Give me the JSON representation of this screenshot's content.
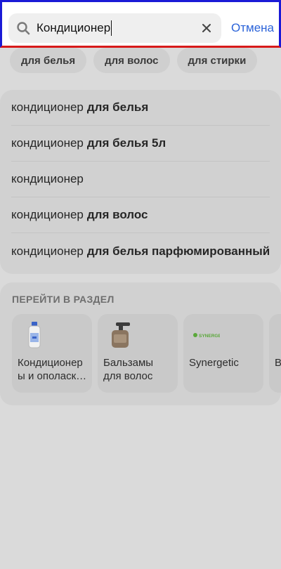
{
  "search": {
    "value": "Кондиционер",
    "cancel_label": "Отмена"
  },
  "chips": [
    {
      "label": "для белья"
    },
    {
      "label": "для волос"
    },
    {
      "label": "для стирки"
    }
  ],
  "suggestions": [
    {
      "prefix": "кондиционер",
      "bold": "для белья"
    },
    {
      "prefix": "кондиционер",
      "bold": "для белья 5л"
    },
    {
      "prefix": "кондиционер",
      "bold": ""
    },
    {
      "prefix": "кондиционер",
      "bold": "для волос"
    },
    {
      "prefix": "кондиционер",
      "bold": "для белья парфюмированный"
    }
  ],
  "sections": {
    "title": "ПЕРЕЙТИ В РАЗДЕЛ",
    "items": [
      {
        "label": "Кондиционер ы и ополаск…",
        "icon": "bottle-icon"
      },
      {
        "label": "Бальзамы для волос",
        "icon": "pump-bottle-icon"
      },
      {
        "label": "Synergetic",
        "icon": "synergetic-logo",
        "logo_text": "SYNERGETIC"
      },
      {
        "label": "В",
        "icon": "bottle-icon"
      }
    ]
  },
  "colors": {
    "accent": "#2b63d9",
    "highlight_top": "#1a1ad6",
    "highlight_bottom": "#d81a1a",
    "logo_green": "#5aa83a"
  }
}
